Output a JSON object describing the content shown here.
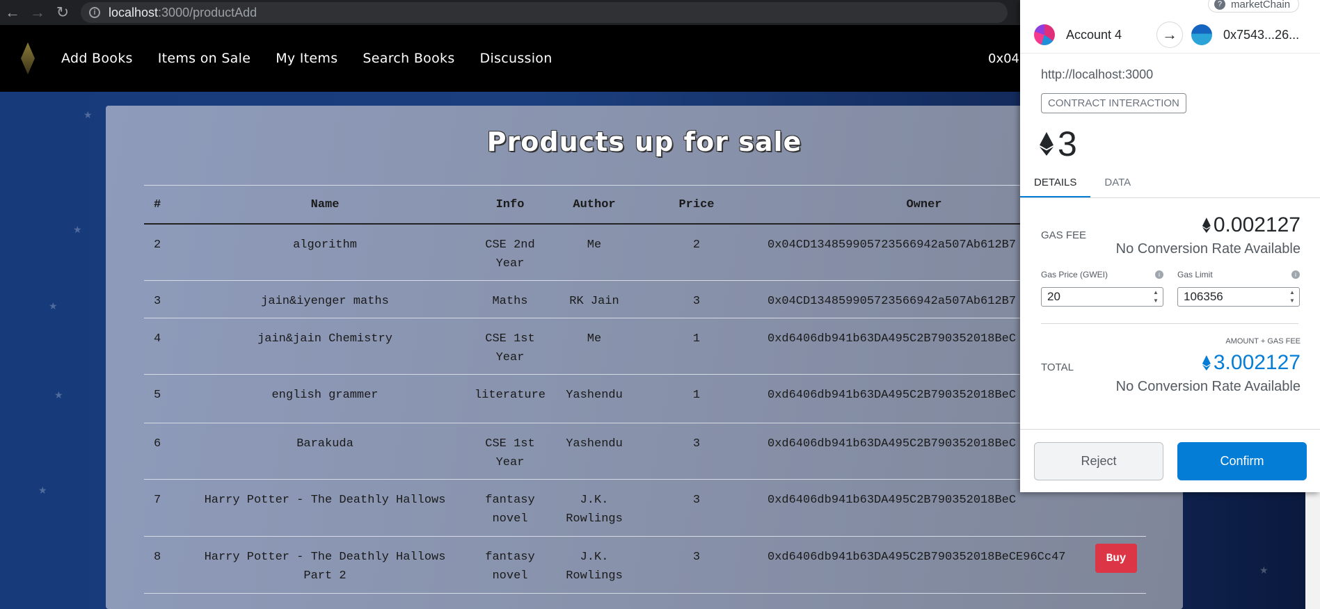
{
  "browser": {
    "url_host": "localhost",
    "url_path": ":3000/productAdd"
  },
  "nav": {
    "links": [
      "Add Books",
      "Items on Sale",
      "My Items",
      "Search Books",
      "Discussion"
    ],
    "account_partial": "0x04"
  },
  "page": {
    "title": "Products up for sale",
    "columns": [
      "#",
      "Name",
      "Info",
      "Author",
      "Price",
      "Owner"
    ],
    "rows": [
      {
        "num": "2",
        "name": "algorithm",
        "info": "CSE 2nd Year",
        "author": "Me",
        "price": "2",
        "owner": "0x04CD134859905723566942a507Ab612B7"
      },
      {
        "num": "3",
        "name": "jain&iyenger maths",
        "info": "Maths",
        "author": "RK Jain",
        "price": "3",
        "owner": "0x04CD134859905723566942a507Ab612B7"
      },
      {
        "num": "4",
        "name": "jain&jain Chemistry",
        "info": "CSE 1st Year",
        "author": "Me",
        "price": "1",
        "owner": "0xd6406db941b63DA495C2B790352018BeC"
      },
      {
        "num": "5",
        "name": "english grammer",
        "info": "literature",
        "author": "Yashendu",
        "price": "1",
        "owner": "0xd6406db941b63DA495C2B790352018BeC"
      },
      {
        "num": "6",
        "name": "Barakuda",
        "info": "CSE 1st Year",
        "author": "Yashendu",
        "price": "3",
        "owner": "0xd6406db941b63DA495C2B790352018BeC"
      },
      {
        "num": "7",
        "name": "Harry Potter - The Deathly Hallows",
        "info": "fantasy novel",
        "author": "J.K. Rowlings",
        "price": "3",
        "owner": "0xd6406db941b63DA495C2B790352018BeC"
      },
      {
        "num": "8",
        "name": "Harry Potter - The Deathly Hallows Part 2",
        "info": "fantasy novel",
        "author": "J.K. Rowlings",
        "price": "3",
        "owner": "0xd6406db941b63DA495C2B790352018BeCE96Cc47",
        "action": "Buy"
      }
    ]
  },
  "metamask": {
    "network": "marketChain",
    "from_account": "Account 4",
    "to_address": "0x7543...26...",
    "origin": "http://localhost:3000",
    "badge": "CONTRACT INTERACTION",
    "amount": "3",
    "tabs": [
      "DETAILS",
      "DATA"
    ],
    "gas_fee_label": "GAS FEE",
    "gas_fee_value": "0.002127",
    "no_rate": "No Conversion Rate Available",
    "gas_price_label": "Gas Price (GWEI)",
    "gas_price_value": "20",
    "gas_limit_label": "Gas Limit",
    "gas_limit_value": "106356",
    "amount_gas_label": "AMOUNT + GAS FEE",
    "total_label": "TOTAL",
    "total_value": "3.002127",
    "no_rate_total": "No Conversion Rate Available",
    "reject_label": "Reject",
    "confirm_label": "Confirm",
    "accent_color": "#037dd6"
  }
}
